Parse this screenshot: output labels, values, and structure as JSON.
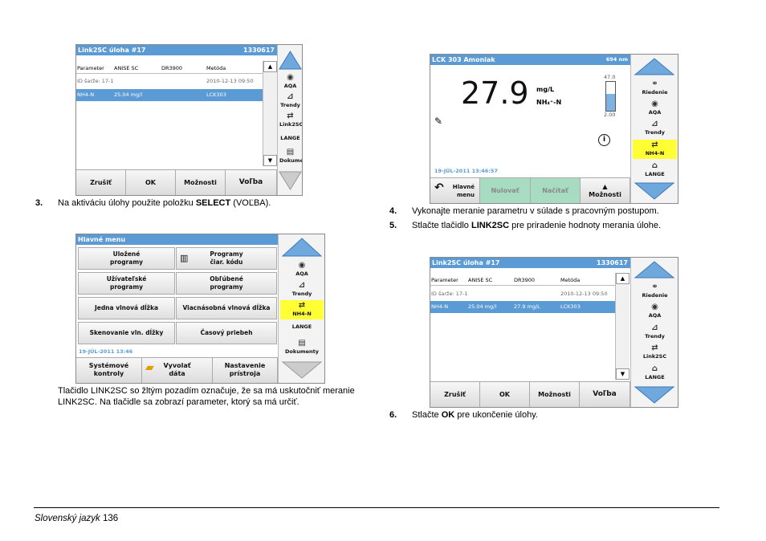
{
  "screen1": {
    "title": "Link2SC úloha #17",
    "number": "1330617",
    "headers": [
      "Parameter",
      "ANISE SC",
      "DR3900",
      "Metóda"
    ],
    "row1": {
      "id": "ID šarže: 17-1",
      "date": "2010-12-13 09:50"
    },
    "row2": {
      "param": "NH4-N",
      "value": "25.04 mg/l",
      "method": "LCK303"
    },
    "buttons": [
      "Zrušiť",
      "OK",
      "Možnosti",
      "Voľba"
    ],
    "side": [
      "AQA",
      "Trendy",
      "Link2SC",
      "LANGE",
      "Dokumenty"
    ]
  },
  "step3": {
    "num": "3.",
    "pre": "Na aktiváciu úlohy použite položku ",
    "bold": "SELECT",
    "post": " (VOĽBA)."
  },
  "screen2": {
    "title": "Hlavné menu",
    "menu": [
      "Uložené\nprogramy",
      "Programy\nčiar. kódu",
      "Užívateľské\nprogramy",
      "Obľúbené\nprogramy",
      "Jedna vlnová dĺžka",
      "Viacnásobná vlnová dĺžka",
      "Skenovanie vln. dĺžky",
      "Časový priebeh"
    ],
    "date": "19-JÚL-2011  13:46",
    "bottom": [
      "Systémové\nkontroly",
      "Vyvolať\ndáta",
      "Nastavenie\nprístroja"
    ],
    "side": [
      "AQA",
      "Trendy",
      "NH4-N",
      "LANGE",
      "Dokumenty"
    ]
  },
  "note": "Tlačidlo LINK2SC so žltým pozadím označuje, že sa má uskutočniť meranie LINK2SC. Na tlačidle sa zobrazí parameter, ktorý sa má určiť.",
  "screen3": {
    "title": "LCK 303 Amoniak",
    "wavelength": "694 nm",
    "value": "27.9",
    "unit": "mg/L",
    "param": "NH₄⁺-N",
    "scale_top": "47.0",
    "scale_bottom": "2.00",
    "date": "19-JÚL-2011  13:46:57",
    "buttons": [
      "Hlavné\nmenu",
      "Nulovať",
      "Načítať",
      "Možnosti"
    ],
    "side": [
      "Riedenie",
      "AQA",
      "Trendy",
      "NH4-N",
      "LANGE"
    ]
  },
  "step4": {
    "num": "4.",
    "text": "Vykonajte meranie parametru v súlade s pracovným postupom."
  },
  "step5": {
    "num": "5.",
    "pre": "Stlačte tlačidlo ",
    "bold": "LINK2SC",
    "post": " pre priradenie hodnoty merania úlohe."
  },
  "screen4": {
    "title": "Link2SC úloha #17",
    "number": "1330617",
    "headers": [
      "Parameter",
      "ANISE SC",
      "DR3900",
      "Metóda"
    ],
    "row1": {
      "id": "ID šarže: 17-1",
      "date": "2010-12-13 09:50"
    },
    "row2": {
      "param": "NH4-N",
      "value": "25.04 mg/l",
      "value2": "27.9 mg/L",
      "method": "LCK303"
    },
    "buttons": [
      "Zrušiť",
      "OK",
      "Možnosti",
      "Voľba"
    ],
    "side": [
      "Riedenie",
      "AQA",
      "Trendy",
      "Link2SC",
      "LANGE"
    ]
  },
  "step6": {
    "num": "6.",
    "pre": "Stlačte ",
    "bold": "OK",
    "post": " pre ukončenie úlohy."
  },
  "footer": {
    "lang": "Slovenský jazyk",
    "page": "136"
  }
}
